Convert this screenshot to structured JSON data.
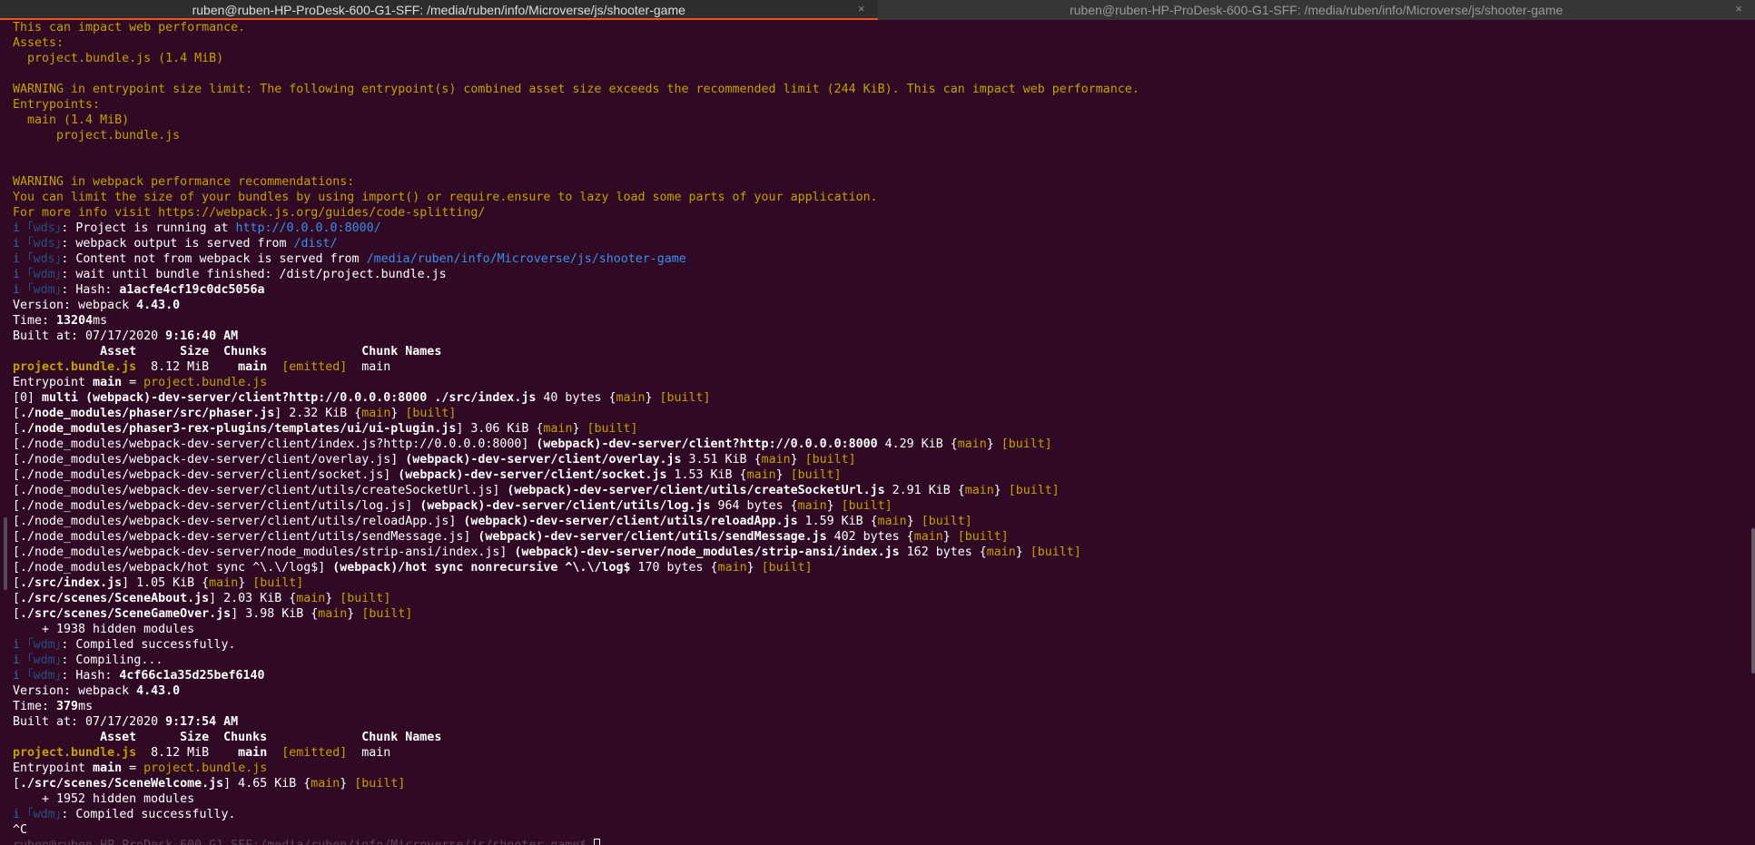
{
  "tabs": [
    {
      "title": "ruben@ruben-HP-ProDesk-600-G1-SFF: /media/ruben/info/Microverse/js/shooter-game",
      "active": true
    },
    {
      "title": "ruben@ruben-HP-ProDesk-600-G1-SFF: /media/ruben/info/Microverse/js/shooter-game",
      "active": false
    }
  ],
  "close_glyph": "×",
  "colors": {
    "background": "#300a24",
    "warning": "#c4a000",
    "info": "#3465a4",
    "link": "#3b8eea",
    "accent": "#e95420"
  },
  "terminal": {
    "lines": [
      [
        [
          "warn",
          "This can impact web performance."
        ]
      ],
      [
        [
          "warn",
          "Assets:"
        ]
      ],
      [
        [
          "warn",
          "  project.bundle.js (1.4 MiB)"
        ]
      ],
      [],
      [
        [
          "warn",
          "WARNING in entrypoint size limit: The following entrypoint(s) combined asset size exceeds the recommended limit (244 KiB). This can impact web performance."
        ]
      ],
      [
        [
          "warn",
          "Entrypoints:"
        ]
      ],
      [
        [
          "warn",
          "  main (1.4 MiB)"
        ]
      ],
      [
        [
          "warn",
          "      project.bundle.js"
        ]
      ],
      [],
      [],
      [
        [
          "warn",
          "WARNING in webpack performance recommendations:"
        ]
      ],
      [
        [
          "warn",
          "You can limit the size of your bundles by using import() or require.ensure to lazy load some parts of your application."
        ]
      ],
      [
        [
          "warn",
          "For more info visit https://webpack.js.org/guides/code-splitting/"
        ]
      ],
      [
        [
          "info",
          "i "
        ],
        [
          "infodim",
          "｢wds｣"
        ],
        [
          "normal",
          ": Project is running at "
        ],
        [
          "link",
          "http://0.0.0.0:8000/"
        ]
      ],
      [
        [
          "info",
          "i "
        ],
        [
          "infodim",
          "｢wds｣"
        ],
        [
          "normal",
          ": webpack output is served from "
        ],
        [
          "link",
          "/dist/"
        ]
      ],
      [
        [
          "info",
          "i "
        ],
        [
          "infodim",
          "｢wds｣"
        ],
        [
          "normal",
          ": Content not from webpack is served from "
        ],
        [
          "link",
          "/media/ruben/info/Microverse/js/shooter-game"
        ]
      ],
      [
        [
          "info",
          "i "
        ],
        [
          "infodim",
          "｢wdm｣"
        ],
        [
          "normal",
          ": wait until bundle finished: /dist/project.bundle.js"
        ]
      ],
      [
        [
          "info",
          "i "
        ],
        [
          "infodim",
          "｢wdm｣"
        ],
        [
          "normal",
          ": Hash: "
        ],
        [
          "bold",
          "a1acfe4cf19c0dc5056a"
        ]
      ],
      [
        [
          "normal",
          "Version: webpack "
        ],
        [
          "bold",
          "4.43.0"
        ]
      ],
      [
        [
          "normal",
          "Time: "
        ],
        [
          "bold",
          "13204"
        ],
        [
          "normal",
          "ms"
        ]
      ],
      [
        [
          "normal",
          "Built at: 07/17/2020 "
        ],
        [
          "bold",
          "9:16:40 AM"
        ]
      ],
      [
        [
          "bold",
          "            Asset      Size  Chunks             Chunk Names"
        ]
      ],
      [
        [
          "warnb",
          "project.bundle.js"
        ],
        [
          "normal",
          "  8.12 MiB    "
        ],
        [
          "bold",
          "main"
        ],
        [
          "normal",
          "  "
        ],
        [
          "warn",
          "[emitted]"
        ],
        [
          "normal",
          "  main"
        ]
      ],
      [
        [
          "normal",
          "Entrypoint "
        ],
        [
          "bold",
          "main"
        ],
        [
          "normal",
          " = "
        ],
        [
          "warn",
          "project.bundle.js"
        ]
      ],
      [
        [
          "normal",
          "[0] "
        ],
        [
          "bold",
          "multi (webpack)-dev-server/client?http://0.0.0.0:8000 ./src/index.js"
        ],
        [
          "normal",
          " 40 bytes {"
        ],
        [
          "warn",
          "main"
        ],
        [
          "normal",
          "} "
        ],
        [
          "warn",
          "[built]"
        ]
      ],
      [
        [
          "normal",
          "["
        ],
        [
          "bold",
          "./node_modules/phaser/src/phaser.js"
        ],
        [
          "normal",
          "] 2.32 KiB {"
        ],
        [
          "warn",
          "main"
        ],
        [
          "normal",
          "} "
        ],
        [
          "warn",
          "[built]"
        ]
      ],
      [
        [
          "normal",
          "["
        ],
        [
          "bold",
          "./node_modules/phaser3-rex-plugins/templates/ui/ui-plugin.js"
        ],
        [
          "normal",
          "] 3.06 KiB {"
        ],
        [
          "warn",
          "main"
        ],
        [
          "normal",
          "} "
        ],
        [
          "warn",
          "[built]"
        ]
      ],
      [
        [
          "normal",
          "[./node_modules/webpack-dev-server/client/index.js?http://0.0.0.0:8000] "
        ],
        [
          "bold",
          "(webpack)-dev-server/client?http://0.0.0.0:8000"
        ],
        [
          "normal",
          " 4.29 KiB {"
        ],
        [
          "warn",
          "main"
        ],
        [
          "normal",
          "} "
        ],
        [
          "warn",
          "[built]"
        ]
      ],
      [
        [
          "normal",
          "[./node_modules/webpack-dev-server/client/overlay.js] "
        ],
        [
          "bold",
          "(webpack)-dev-server/client/overlay.js"
        ],
        [
          "normal",
          " 3.51 KiB {"
        ],
        [
          "warn",
          "main"
        ],
        [
          "normal",
          "} "
        ],
        [
          "warn",
          "[built]"
        ]
      ],
      [
        [
          "normal",
          "[./node_modules/webpack-dev-server/client/socket.js] "
        ],
        [
          "bold",
          "(webpack)-dev-server/client/socket.js"
        ],
        [
          "normal",
          " 1.53 KiB {"
        ],
        [
          "warn",
          "main"
        ],
        [
          "normal",
          "} "
        ],
        [
          "warn",
          "[built]"
        ]
      ],
      [
        [
          "normal",
          "[./node_modules/webpack-dev-server/client/utils/createSocketUrl.js] "
        ],
        [
          "bold",
          "(webpack)-dev-server/client/utils/createSocketUrl.js"
        ],
        [
          "normal",
          " 2.91 KiB {"
        ],
        [
          "warn",
          "main"
        ],
        [
          "normal",
          "} "
        ],
        [
          "warn",
          "[built]"
        ]
      ],
      [
        [
          "normal",
          "[./node_modules/webpack-dev-server/client/utils/log.js] "
        ],
        [
          "bold",
          "(webpack)-dev-server/client/utils/log.js"
        ],
        [
          "normal",
          " 964 bytes {"
        ],
        [
          "warn",
          "main"
        ],
        [
          "normal",
          "} "
        ],
        [
          "warn",
          "[built]"
        ]
      ],
      [
        [
          "normal",
          "[./node_modules/webpack-dev-server/client/utils/reloadApp.js] "
        ],
        [
          "bold",
          "(webpack)-dev-server/client/utils/reloadApp.js"
        ],
        [
          "normal",
          " 1.59 KiB {"
        ],
        [
          "warn",
          "main"
        ],
        [
          "normal",
          "} "
        ],
        [
          "warn",
          "[built]"
        ]
      ],
      [
        [
          "normal",
          "[./node_modules/webpack-dev-server/client/utils/sendMessage.js] "
        ],
        [
          "bold",
          "(webpack)-dev-server/client/utils/sendMessage.js"
        ],
        [
          "normal",
          " 402 bytes {"
        ],
        [
          "warn",
          "main"
        ],
        [
          "normal",
          "} "
        ],
        [
          "warn",
          "[built]"
        ]
      ],
      [
        [
          "normal",
          "[./node_modules/webpack-dev-server/node_modules/strip-ansi/index.js] "
        ],
        [
          "bold",
          "(webpack)-dev-server/node_modules/strip-ansi/index.js"
        ],
        [
          "normal",
          " 162 bytes {"
        ],
        [
          "warn",
          "main"
        ],
        [
          "normal",
          "} "
        ],
        [
          "warn",
          "[built]"
        ]
      ],
      [
        [
          "normal",
          "[./node_modules/webpack/hot sync ^\\.\\/log$] "
        ],
        [
          "bold",
          "(webpack)/hot sync nonrecursive ^\\.\\/log$"
        ],
        [
          "normal",
          " 170 bytes {"
        ],
        [
          "warn",
          "main"
        ],
        [
          "normal",
          "} "
        ],
        [
          "warn",
          "[built]"
        ]
      ],
      [
        [
          "normal",
          "["
        ],
        [
          "bold",
          "./src/index.js"
        ],
        [
          "normal",
          "] 1.05 KiB {"
        ],
        [
          "warn",
          "main"
        ],
        [
          "normal",
          "} "
        ],
        [
          "warn",
          "[built]"
        ]
      ],
      [
        [
          "normal",
          "["
        ],
        [
          "bold",
          "./src/scenes/SceneAbout.js"
        ],
        [
          "normal",
          "] 2.03 KiB {"
        ],
        [
          "warn",
          "main"
        ],
        [
          "normal",
          "} "
        ],
        [
          "warn",
          "[built]"
        ]
      ],
      [
        [
          "normal",
          "["
        ],
        [
          "bold",
          "./src/scenes/SceneGameOver.js"
        ],
        [
          "normal",
          "] 3.98 KiB {"
        ],
        [
          "warn",
          "main"
        ],
        [
          "normal",
          "} "
        ],
        [
          "warn",
          "[built]"
        ]
      ],
      [
        [
          "normal",
          "    + 1938 hidden modules"
        ]
      ],
      [
        [
          "info",
          "i "
        ],
        [
          "infodim",
          "｢wdm｣"
        ],
        [
          "normal",
          ": Compiled successfully."
        ]
      ],
      [
        [
          "info",
          "i "
        ],
        [
          "infodim",
          "｢wdm｣"
        ],
        [
          "normal",
          ": Compiling..."
        ]
      ],
      [
        [
          "info",
          "i "
        ],
        [
          "infodim",
          "｢wdm｣"
        ],
        [
          "normal",
          ": Hash: "
        ],
        [
          "bold",
          "4cf66c1a35d25bef6140"
        ]
      ],
      [
        [
          "normal",
          "Version: webpack "
        ],
        [
          "bold",
          "4.43.0"
        ]
      ],
      [
        [
          "normal",
          "Time: "
        ],
        [
          "bold",
          "379"
        ],
        [
          "normal",
          "ms"
        ]
      ],
      [
        [
          "normal",
          "Built at: 07/17/2020 "
        ],
        [
          "bold",
          "9:17:54 AM"
        ]
      ],
      [
        [
          "bold",
          "            Asset      Size  Chunks             Chunk Names"
        ]
      ],
      [
        [
          "warnb",
          "project.bundle.js"
        ],
        [
          "normal",
          "  8.12 MiB    "
        ],
        [
          "bold",
          "main"
        ],
        [
          "normal",
          "  "
        ],
        [
          "warn",
          "[emitted]"
        ],
        [
          "normal",
          "  main"
        ]
      ],
      [
        [
          "normal",
          "Entrypoint "
        ],
        [
          "bold",
          "main"
        ],
        [
          "normal",
          " = "
        ],
        [
          "warn",
          "project.bundle.js"
        ]
      ],
      [
        [
          "normal",
          "["
        ],
        [
          "bold",
          "./src/scenes/SceneWelcome.js"
        ],
        [
          "normal",
          "] 4.65 KiB {"
        ],
        [
          "warn",
          "main"
        ],
        [
          "normal",
          "} "
        ],
        [
          "warn",
          "[built]"
        ]
      ],
      [
        [
          "normal",
          "    + 1952 hidden modules"
        ]
      ],
      [
        [
          "info",
          "i "
        ],
        [
          "infodim",
          "｢wdm｣"
        ],
        [
          "normal",
          ": Compiled successfully."
        ]
      ],
      [
        [
          "normal",
          "^C"
        ]
      ],
      [
        [
          "faint",
          "ruben@ruben-HP-ProDesk-600-G1-SFF:/media/ruben/info/Microverse/js/shooter-game$ "
        ],
        [
          "cursor",
          ""
        ]
      ]
    ]
  }
}
